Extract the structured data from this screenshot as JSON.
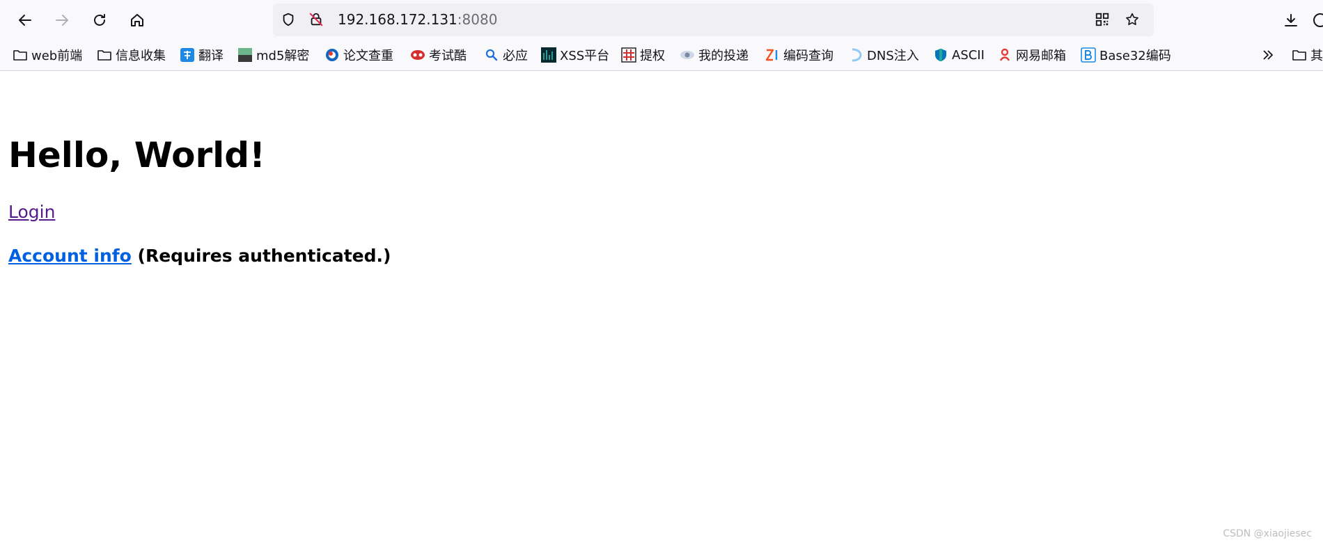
{
  "browser": {
    "url_host": "192.168.172.131",
    "url_port": ":8080",
    "icons": {
      "back": "back-arrow-icon",
      "forward": "forward-arrow-icon",
      "reload": "reload-icon",
      "home": "home-icon",
      "shield": "tracking-shield-icon",
      "insecure": "insecure-lock-icon",
      "qr": "qr-code-icon",
      "star": "bookmark-star-icon",
      "download": "download-icon"
    }
  },
  "bookmarks": {
    "items": [
      {
        "label": "web前端",
        "icon": "folder-icon"
      },
      {
        "label": "信息收集",
        "icon": "folder-icon"
      },
      {
        "label": "翻译",
        "icon": "translate-icon"
      },
      {
        "label": "md5解密",
        "icon": "md5-icon"
      },
      {
        "label": "论文查重",
        "icon": "paper-check-icon"
      },
      {
        "label": "考试酷",
        "icon": "exam-icon"
      },
      {
        "label": "必应",
        "icon": "bing-search-icon"
      },
      {
        "label": "XSS平台",
        "icon": "xss-icon"
      },
      {
        "label": "提权",
        "icon": "hash-grid-icon"
      },
      {
        "label": "我的投递",
        "icon": "eye-icon"
      },
      {
        "label": "编码查询",
        "icon": "zi-icon"
      },
      {
        "label": "DNS注入",
        "icon": "dns-icon"
      },
      {
        "label": "ASCII",
        "icon": "ascii-shield-icon"
      },
      {
        "label": "网易邮箱",
        "icon": "netease-mail-icon"
      },
      {
        "label": "Base32编码",
        "icon": "base32-icon"
      }
    ],
    "overflow_icon": "chevron-double-right-icon",
    "other_label": "其"
  },
  "page": {
    "title": "Hello, World!",
    "login_link": "Login",
    "account_link": "Account info",
    "account_note": " (Requires authenticated.)"
  },
  "watermark": "CSDN @xiaojiesec",
  "colors": {
    "toolbar_bg": "#f9f9fb",
    "urlbar_bg": "#f0f0f4",
    "visited_link": "#551a8b",
    "link": "#0060df"
  }
}
